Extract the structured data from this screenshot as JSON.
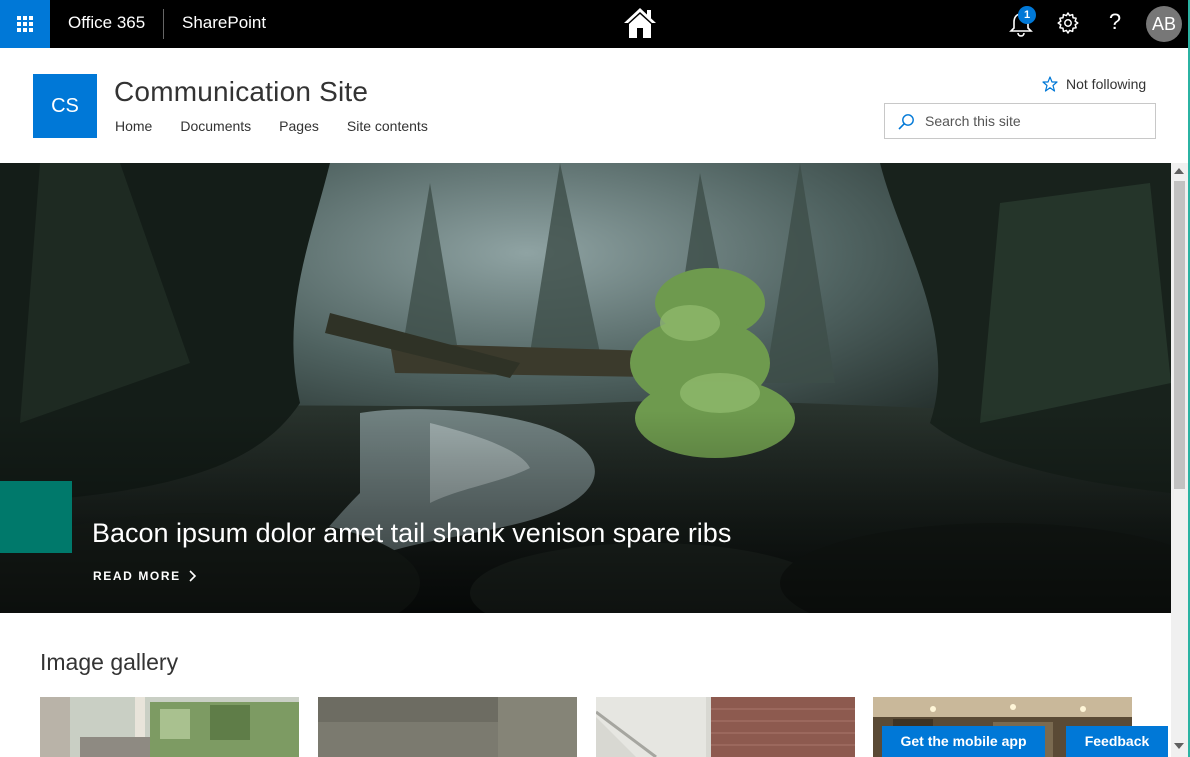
{
  "suite_bar": {
    "app_launcher_icon": "waffle-icon",
    "office_label": "Office 365",
    "app_label": "SharePoint",
    "home_icon": "home-icon",
    "notification_count": "1",
    "help_label": "?",
    "user_initials": "AB"
  },
  "site": {
    "logo_initials": "CS",
    "title": "Communication Site",
    "nav": [
      "Home",
      "Documents",
      "Pages",
      "Site contents"
    ],
    "follow_label": "Not following",
    "search_placeholder": "Search this site"
  },
  "hero": {
    "title": "Bacon ipsum dolor amet tail shank venison spare ribs",
    "read_more": "READ MORE",
    "accent_color": "#00796b"
  },
  "gallery": {
    "title": "Image gallery"
  },
  "bottom": {
    "mobile_app_label": "Get the mobile app",
    "feedback_label": "Feedback"
  },
  "colors": {
    "suite_bar": "#000000",
    "brand_blue": "#0078d7",
    "hero_accent": "#00796b"
  }
}
